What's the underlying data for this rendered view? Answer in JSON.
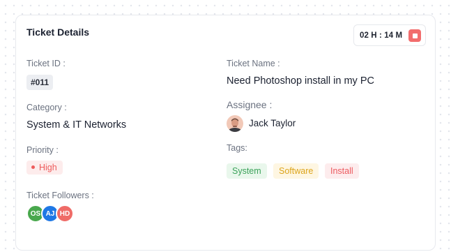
{
  "card": {
    "title": "Ticket Details",
    "timer": "02 H : 14 M"
  },
  "fields": {
    "ticket_id_label": "Ticket ID :",
    "ticket_id_value": "#011",
    "ticket_name_label": "Ticket Name :",
    "ticket_name_value": "Need Photoshop install in my PC",
    "category_label": "Category :",
    "category_value": "System & IT Networks",
    "assignee_label": "Assignee :",
    "assignee_name": "Jack Taylor",
    "priority_label": "Priority :",
    "priority_value": "High",
    "tags_label": "Tags:",
    "followers_label": "Ticket Followers :"
  },
  "tags": [
    {
      "label": "System",
      "color": "#3ba25a"
    },
    {
      "label": "Software",
      "color": "#dca41a"
    },
    {
      "label": "Install",
      "color": "#ec5a5f"
    }
  ],
  "followers": [
    {
      "initials": "OS",
      "color": "#49a84d"
    },
    {
      "initials": "AJ",
      "color": "#1f78e5"
    },
    {
      "initials": "HD",
      "color": "#ef6b67"
    }
  ],
  "colors": {
    "stop_button": "#f26d6d",
    "priority_high": "#ee5b5b"
  },
  "icons": {
    "stop": "stop-square-icon",
    "priority_dot": "dot-icon"
  }
}
